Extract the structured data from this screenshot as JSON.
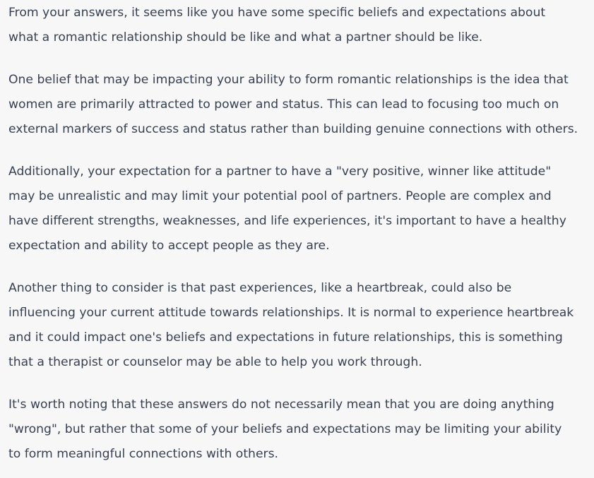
{
  "response": {
    "paragraphs": [
      {
        "lines": [
          "From your answers, it seems like you have some specific beliefs and expectations about",
          "what a romantic relationship should be like and what a partner should be like."
        ]
      },
      {
        "lines": [
          "One belief that may be impacting your ability to form romantic relationships is the idea that",
          "women are primarily attracted to power and status. This can lead to focusing too much on",
          "external markers of success and status rather than building genuine connections with others."
        ]
      },
      {
        "lines": [
          "Additionally, your expectation for a partner to have a \"very positive, winner like attitude\"",
          "may be unrealistic and may limit your potential pool of partners. People are complex and",
          "have different strengths, weaknesses, and life experiences, it's important to have a healthy",
          "expectation and ability to accept people as they are."
        ]
      },
      {
        "lines": [
          "Another thing to consider is that past experiences, like a heartbreak, could also be",
          "influencing your current attitude towards relationships. It is normal to experience heartbreak",
          "and it could impact one's beliefs and expectations in future relationships, this is something",
          "that a therapist or counselor may be able to help you work through."
        ]
      },
      {
        "lines": [
          "It's worth noting that these answers do not necessarily mean that you are doing anything",
          "\"wrong\", but rather that some of your beliefs and expectations may be limiting your ability",
          "to form meaningful connections with others."
        ]
      }
    ]
  },
  "colors": {
    "background": "#f7f7f8",
    "text": "#374151"
  }
}
